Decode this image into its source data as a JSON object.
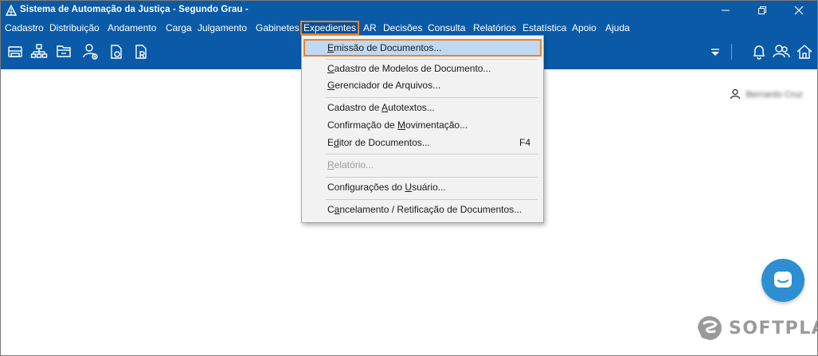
{
  "window": {
    "title": "Sistema de Automação da Justiça - Segundo Grau -",
    "title_color": "#0a5aa8"
  },
  "menubar": {
    "items": [
      {
        "label": "Cadastro"
      },
      {
        "label": "Distribuição"
      },
      {
        "label": "Andamento"
      },
      {
        "label": "Carga"
      },
      {
        "label": "Julgamento"
      },
      {
        "label": "Gabinetes"
      },
      {
        "label": "Expedientes",
        "active": true
      },
      {
        "label": "AR"
      },
      {
        "label": "Decisões"
      },
      {
        "label": "Consulta"
      },
      {
        "label": "Relatórios"
      },
      {
        "label": "Estatística"
      },
      {
        "label": "Apoio"
      },
      {
        "label": "Ajuda"
      }
    ],
    "highlight_color": "#e8832a"
  },
  "toolbar": {
    "icons": [
      "printer-icon",
      "org-chart-icon",
      "folder-icon",
      "user-settings-icon",
      "document-o-icon",
      "document-r-icon"
    ],
    "right_icons": [
      "dropdown-arrow-icon",
      "bell-icon",
      "users-icon",
      "home-icon"
    ]
  },
  "dropdown": {
    "items": [
      {
        "pre": "",
        "u": "E",
        "post": "missão de Documentos...",
        "highlight": true
      },
      {
        "pre": "",
        "u": "C",
        "post": "adastro de Modelos de Documento..."
      },
      {
        "pre": "",
        "u": "G",
        "post": "erenciador de Arquivos..."
      },
      {
        "pre": "Cadastro de ",
        "u": "A",
        "post": "utotextos..."
      },
      {
        "pre": "Confirmação de ",
        "u": "M",
        "post": "ovimentação..."
      },
      {
        "pre": "E",
        "u": "d",
        "post": "itor de Documentos...",
        "shortcut": "F4"
      },
      {
        "pre": "",
        "u": "R",
        "post": "elatório...",
        "disabled": true
      },
      {
        "pre": "Configurações do ",
        "u": "U",
        "post": "suário..."
      },
      {
        "pre": "C",
        "u": "a",
        "post": "ncelamento / Retificação de Documentos..."
      }
    ]
  },
  "user": {
    "name": "Bernardo Cruz"
  },
  "brand": {
    "logo_text": "SOFTPLAN"
  }
}
